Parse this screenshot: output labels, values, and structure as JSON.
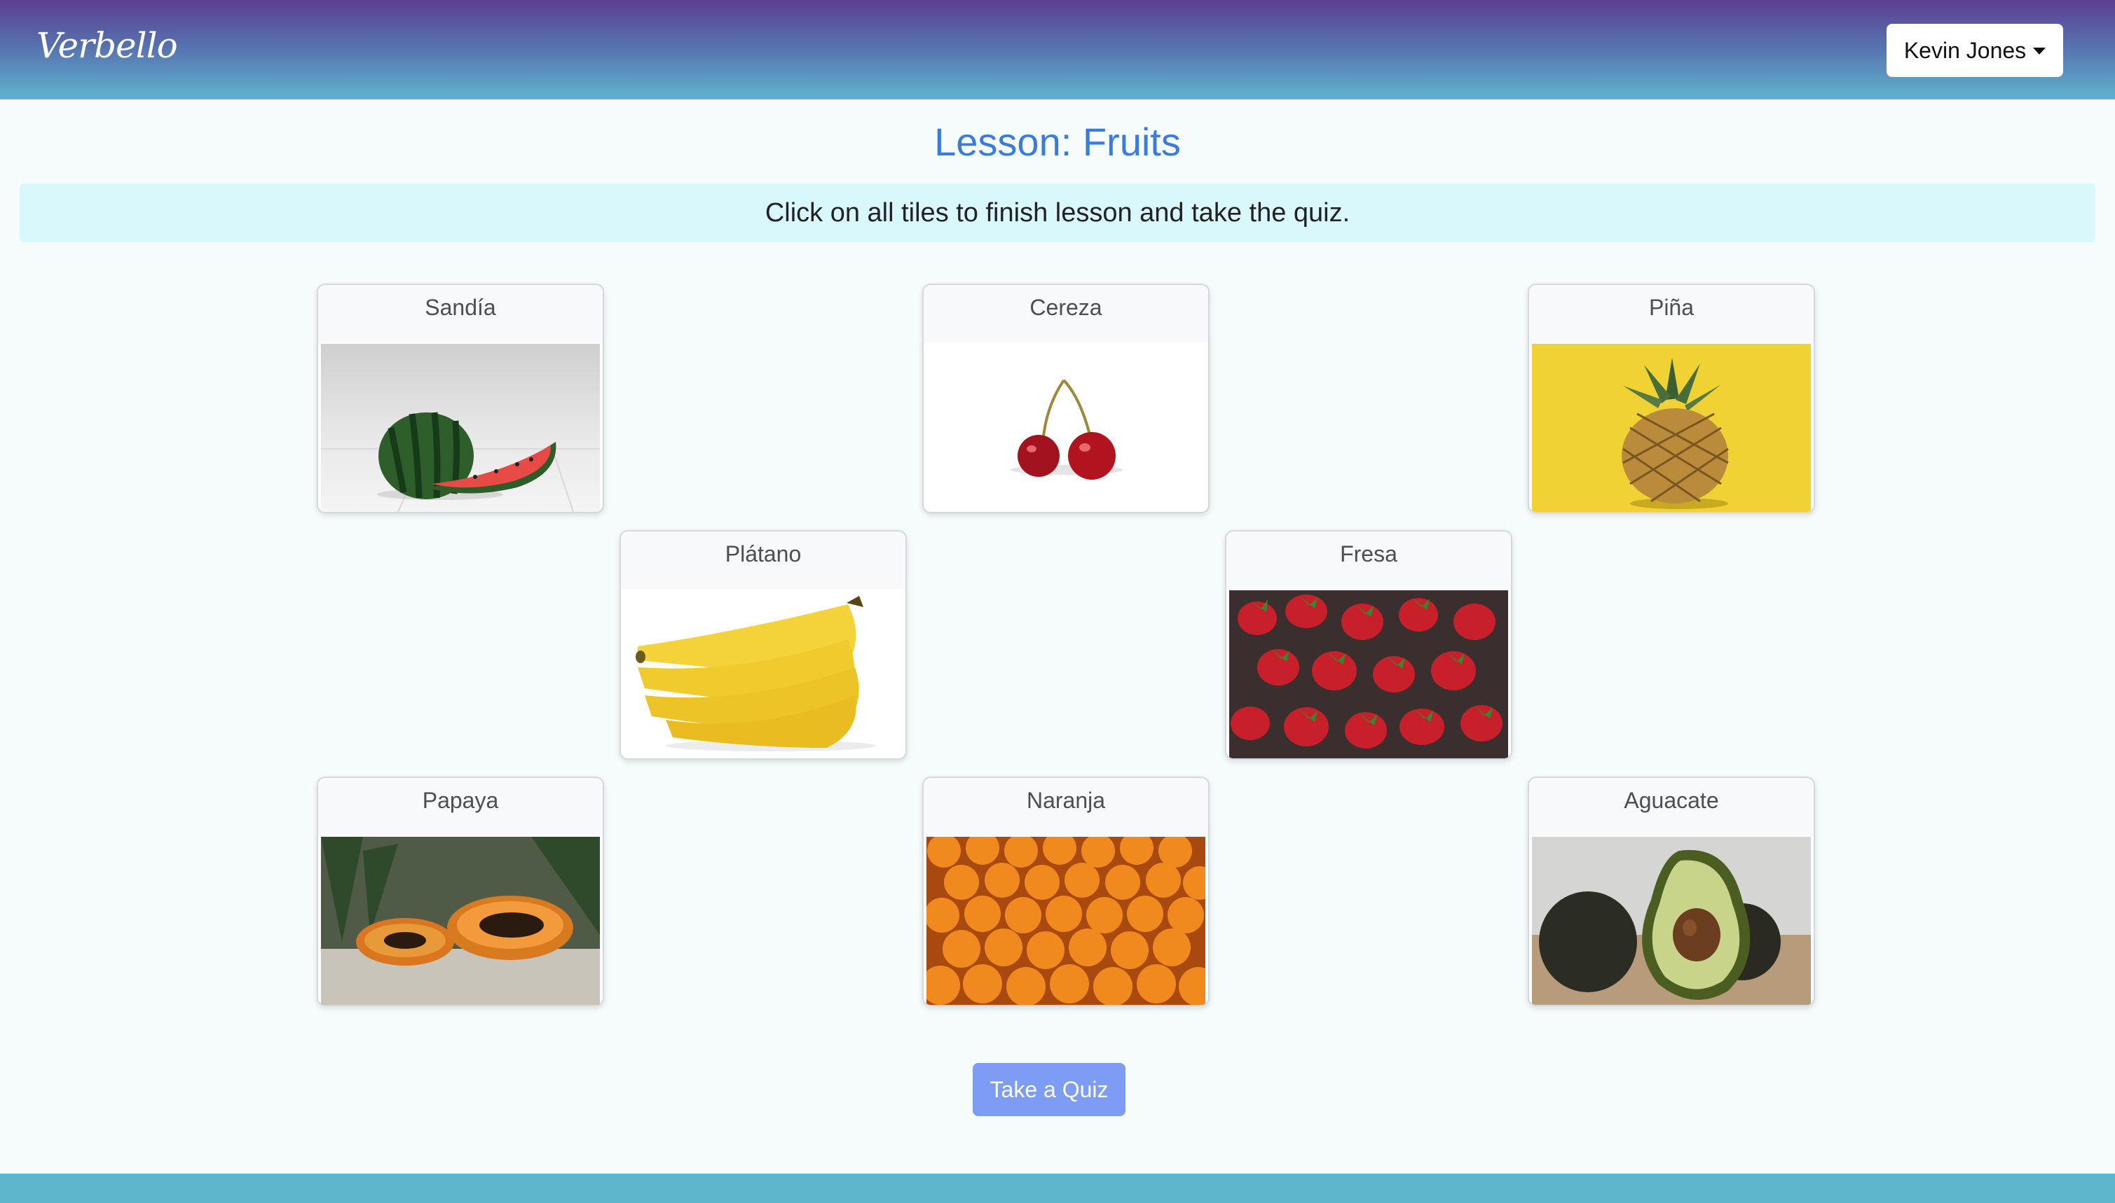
{
  "brand": "Verbello",
  "user_menu": {
    "label": "Kevin Jones"
  },
  "lesson": {
    "title": "Lesson: Fruits",
    "instruction": "Click on all tiles to finish lesson and take the quiz."
  },
  "tiles": [
    {
      "label": "Sandía",
      "image": "watermelon"
    },
    {
      "label": "Cereza",
      "image": "cherries"
    },
    {
      "label": "Piña",
      "image": "pineapple"
    },
    {
      "label": "Plátano",
      "image": "bananas"
    },
    {
      "label": "Fresa",
      "image": "strawberries"
    },
    {
      "label": "Papaya",
      "image": "papaya"
    },
    {
      "label": "Naranja",
      "image": "oranges"
    },
    {
      "label": "Aguacate",
      "image": "avocado"
    }
  ],
  "quiz_button": "Take a Quiz"
}
